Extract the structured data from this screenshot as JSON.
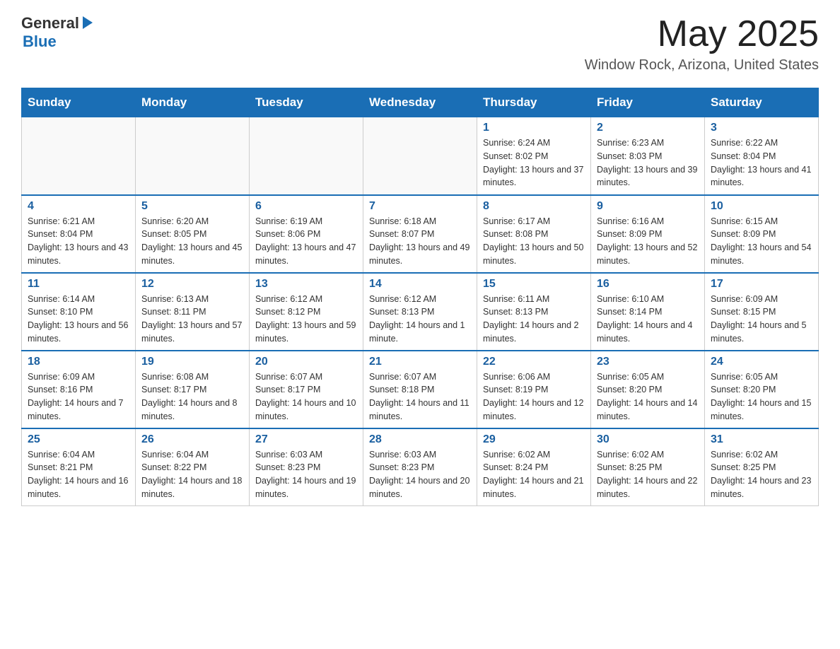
{
  "header": {
    "logo": {
      "general": "General",
      "blue": "Blue",
      "arrow": "▶"
    },
    "title": "May 2025",
    "subtitle": "Window Rock, Arizona, United States"
  },
  "weekdays": [
    "Sunday",
    "Monday",
    "Tuesday",
    "Wednesday",
    "Thursday",
    "Friday",
    "Saturday"
  ],
  "weeks": [
    [
      {
        "day": "",
        "info": ""
      },
      {
        "day": "",
        "info": ""
      },
      {
        "day": "",
        "info": ""
      },
      {
        "day": "",
        "info": ""
      },
      {
        "day": "1",
        "info": "Sunrise: 6:24 AM\nSunset: 8:02 PM\nDaylight: 13 hours and 37 minutes."
      },
      {
        "day": "2",
        "info": "Sunrise: 6:23 AM\nSunset: 8:03 PM\nDaylight: 13 hours and 39 minutes."
      },
      {
        "day": "3",
        "info": "Sunrise: 6:22 AM\nSunset: 8:04 PM\nDaylight: 13 hours and 41 minutes."
      }
    ],
    [
      {
        "day": "4",
        "info": "Sunrise: 6:21 AM\nSunset: 8:04 PM\nDaylight: 13 hours and 43 minutes."
      },
      {
        "day": "5",
        "info": "Sunrise: 6:20 AM\nSunset: 8:05 PM\nDaylight: 13 hours and 45 minutes."
      },
      {
        "day": "6",
        "info": "Sunrise: 6:19 AM\nSunset: 8:06 PM\nDaylight: 13 hours and 47 minutes."
      },
      {
        "day": "7",
        "info": "Sunrise: 6:18 AM\nSunset: 8:07 PM\nDaylight: 13 hours and 49 minutes."
      },
      {
        "day": "8",
        "info": "Sunrise: 6:17 AM\nSunset: 8:08 PM\nDaylight: 13 hours and 50 minutes."
      },
      {
        "day": "9",
        "info": "Sunrise: 6:16 AM\nSunset: 8:09 PM\nDaylight: 13 hours and 52 minutes."
      },
      {
        "day": "10",
        "info": "Sunrise: 6:15 AM\nSunset: 8:09 PM\nDaylight: 13 hours and 54 minutes."
      }
    ],
    [
      {
        "day": "11",
        "info": "Sunrise: 6:14 AM\nSunset: 8:10 PM\nDaylight: 13 hours and 56 minutes."
      },
      {
        "day": "12",
        "info": "Sunrise: 6:13 AM\nSunset: 8:11 PM\nDaylight: 13 hours and 57 minutes."
      },
      {
        "day": "13",
        "info": "Sunrise: 6:12 AM\nSunset: 8:12 PM\nDaylight: 13 hours and 59 minutes."
      },
      {
        "day": "14",
        "info": "Sunrise: 6:12 AM\nSunset: 8:13 PM\nDaylight: 14 hours and 1 minute."
      },
      {
        "day": "15",
        "info": "Sunrise: 6:11 AM\nSunset: 8:13 PM\nDaylight: 14 hours and 2 minutes."
      },
      {
        "day": "16",
        "info": "Sunrise: 6:10 AM\nSunset: 8:14 PM\nDaylight: 14 hours and 4 minutes."
      },
      {
        "day": "17",
        "info": "Sunrise: 6:09 AM\nSunset: 8:15 PM\nDaylight: 14 hours and 5 minutes."
      }
    ],
    [
      {
        "day": "18",
        "info": "Sunrise: 6:09 AM\nSunset: 8:16 PM\nDaylight: 14 hours and 7 minutes."
      },
      {
        "day": "19",
        "info": "Sunrise: 6:08 AM\nSunset: 8:17 PM\nDaylight: 14 hours and 8 minutes."
      },
      {
        "day": "20",
        "info": "Sunrise: 6:07 AM\nSunset: 8:17 PM\nDaylight: 14 hours and 10 minutes."
      },
      {
        "day": "21",
        "info": "Sunrise: 6:07 AM\nSunset: 8:18 PM\nDaylight: 14 hours and 11 minutes."
      },
      {
        "day": "22",
        "info": "Sunrise: 6:06 AM\nSunset: 8:19 PM\nDaylight: 14 hours and 12 minutes."
      },
      {
        "day": "23",
        "info": "Sunrise: 6:05 AM\nSunset: 8:20 PM\nDaylight: 14 hours and 14 minutes."
      },
      {
        "day": "24",
        "info": "Sunrise: 6:05 AM\nSunset: 8:20 PM\nDaylight: 14 hours and 15 minutes."
      }
    ],
    [
      {
        "day": "25",
        "info": "Sunrise: 6:04 AM\nSunset: 8:21 PM\nDaylight: 14 hours and 16 minutes."
      },
      {
        "day": "26",
        "info": "Sunrise: 6:04 AM\nSunset: 8:22 PM\nDaylight: 14 hours and 18 minutes."
      },
      {
        "day": "27",
        "info": "Sunrise: 6:03 AM\nSunset: 8:23 PM\nDaylight: 14 hours and 19 minutes."
      },
      {
        "day": "28",
        "info": "Sunrise: 6:03 AM\nSunset: 8:23 PM\nDaylight: 14 hours and 20 minutes."
      },
      {
        "day": "29",
        "info": "Sunrise: 6:02 AM\nSunset: 8:24 PM\nDaylight: 14 hours and 21 minutes."
      },
      {
        "day": "30",
        "info": "Sunrise: 6:02 AM\nSunset: 8:25 PM\nDaylight: 14 hours and 22 minutes."
      },
      {
        "day": "31",
        "info": "Sunrise: 6:02 AM\nSunset: 8:25 PM\nDaylight: 14 hours and 23 minutes."
      }
    ]
  ]
}
